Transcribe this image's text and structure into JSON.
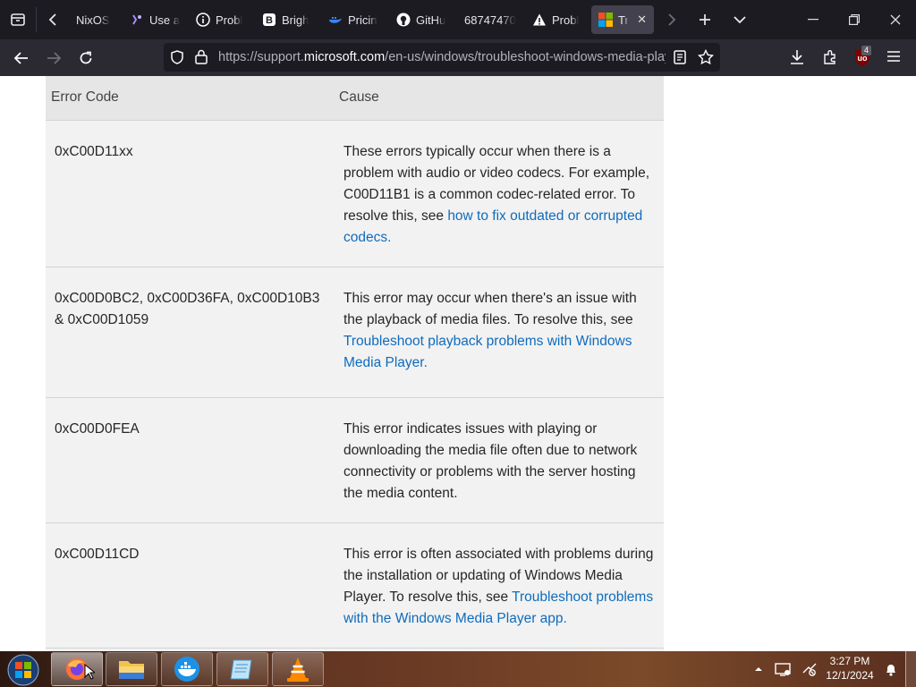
{
  "browser": {
    "tabs": [
      {
        "title": "NixOS",
        "icon": "nixos-icon"
      },
      {
        "title": "Use a",
        "icon": "ai-sparkle-icon"
      },
      {
        "title": "Probl",
        "icon": "info-circle-icon"
      },
      {
        "title": "Brigh",
        "icon": "bold-b-icon"
      },
      {
        "title": "Pricin",
        "icon": "whale-icon"
      },
      {
        "title": "GitHu",
        "icon": "github-icon"
      },
      {
        "title": "68747470",
        "icon": ""
      },
      {
        "title": "Probl",
        "icon": "warning-triangle-icon"
      },
      {
        "title": "Tro",
        "icon": "microsoft-logo-icon",
        "active": true
      }
    ],
    "url": {
      "prefix": "https://support.",
      "domain": "microsoft.com",
      "path": "/en-us/windows/troubleshoot-windows-media-playe"
    },
    "extension_badge": "4"
  },
  "table": {
    "headers": [
      "Error Code",
      "Cause"
    ],
    "rows": [
      {
        "code": "0xC00D11xx",
        "cause": "These errors typically occur when there is a problem with audio or video codecs. For example, C00D11B1 is a common codec-related error. To resolve this, see ",
        "link": "how to fix outdated or corrupted codecs."
      },
      {
        "code": "0xC00D0BC2, 0xC00D36FA, 0xC00D10B3 & 0xC00D1059",
        "cause": "This error may occur when there's an issue with the playback of media files. To resolve this, see ",
        "link": "Troubleshoot playback problems with Windows Media Player."
      },
      {
        "code": "0xC00D0FEA",
        "cause": "This error indicates issues with playing or downloading the media file often due to network connectivity or problems with the server hosting the media content.",
        "link": ""
      },
      {
        "code": "0xC00D11CD",
        "cause": "This error is often associated with problems during the installation or updating of Windows Media Player. To resolve this, see ",
        "link": "Troubleshoot problems with the Windows Media Player app."
      }
    ]
  },
  "taskbar": {
    "apps": [
      "firefox",
      "file-explorer",
      "docker",
      "notepad",
      "vlc"
    ],
    "time": "3:27 PM",
    "date": "12/1/2024"
  },
  "colors": {
    "tabbar_bg": "#1c1b22",
    "navbar_bg": "#2b2a33",
    "link": "#0f6cbd",
    "table_header_bg": "#e6e6e6",
    "table_row_bg": "#f2f2f2"
  }
}
